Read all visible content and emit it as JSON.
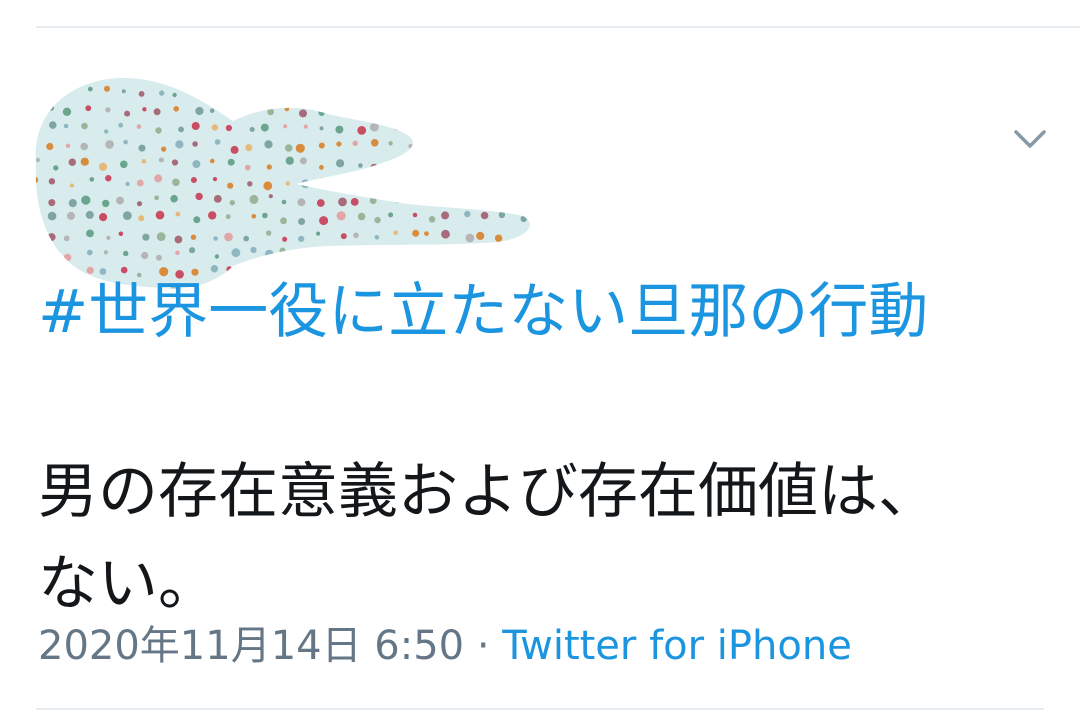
{
  "header": {
    "menu_icon": "chevron-down-icon",
    "avatar_redacted": true
  },
  "tweet": {
    "hashtag": "#世界一役に立たない旦那の行動",
    "body_lines": [
      "男の存在意義および存在価値は、",
      "ない。"
    ],
    "timestamp": "2020年11月14日 6:50",
    "separator": " · ",
    "source": "Twitter for iPhone"
  },
  "colors": {
    "link": "#1b95e0",
    "text": "#14171a",
    "meta": "#657786",
    "divider": "#e6ecf0",
    "redaction_fill": "#d8ecee"
  }
}
